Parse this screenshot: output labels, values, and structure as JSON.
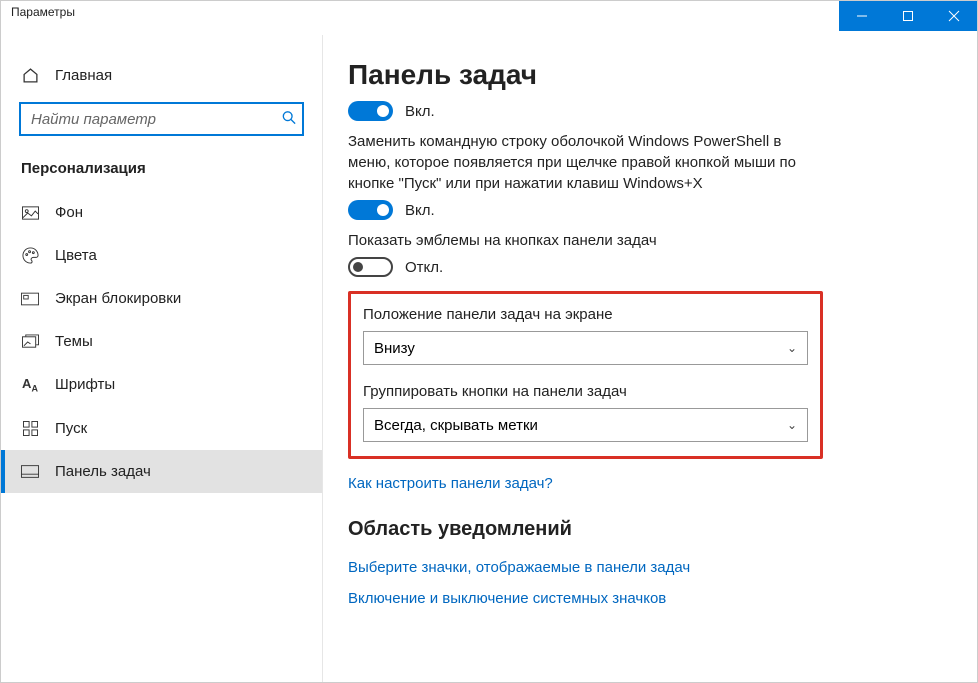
{
  "window": {
    "title": "Параметры"
  },
  "sidebar": {
    "home": "Главная",
    "search_placeholder": "Найти параметр",
    "category": "Персонализация",
    "items": [
      {
        "label": "Фон"
      },
      {
        "label": "Цвета"
      },
      {
        "label": "Экран блокировки"
      },
      {
        "label": "Темы"
      },
      {
        "label": "Шрифты"
      },
      {
        "label": "Пуск"
      },
      {
        "label": "Панель задач"
      }
    ]
  },
  "main": {
    "title": "Панель задач",
    "toggle1_state": "Вкл.",
    "desc1": "Заменить командную строку оболочкой Windows PowerShell в меню, которое появляется при щелчке правой кнопкой мыши по кнопке \"Пуск\" или при нажатии клавиш Windows+X",
    "toggle2_state": "Вкл.",
    "desc2": "Показать эмблемы на кнопках панели задач",
    "toggle3_state": "Откл.",
    "position_label": "Положение панели задач на экране",
    "position_value": "Внизу",
    "group_label": "Группировать кнопки на панели задач",
    "group_value": "Всегда, скрывать метки",
    "link1": "Как настроить панели задач?",
    "section2": "Область уведомлений",
    "link2": "Выберите значки, отображаемые в панели задач",
    "link3": "Включение и выключение системных значков"
  }
}
